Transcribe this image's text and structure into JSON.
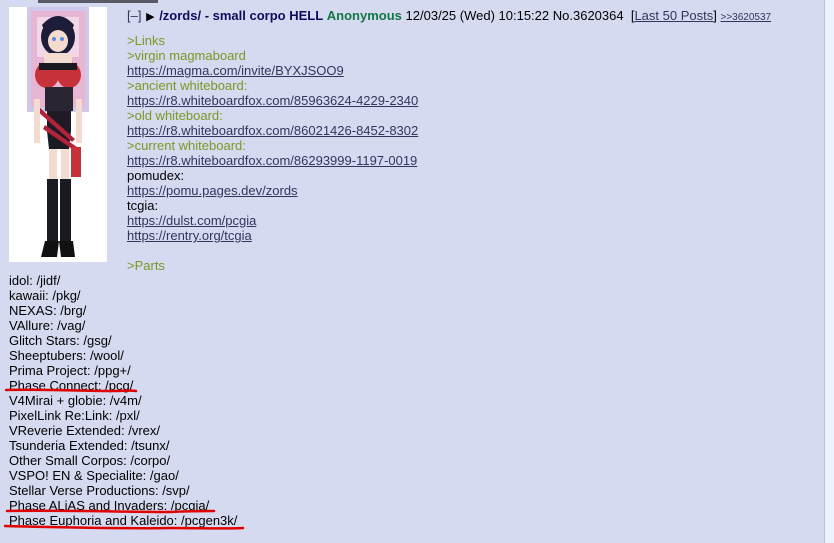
{
  "post": {
    "hide_label": "[–]",
    "subject": "/zords/ - small corpo HELL",
    "name": "Anonymous",
    "datetime": "12/03/25 (Wed) 10:15:22",
    "post_no": "No.3620364",
    "last50_label": "Last 50 Posts",
    "backlink": ">>3620537"
  },
  "body_upper": [
    {
      "kind": "quote",
      "text": ">Links"
    },
    {
      "kind": "quote",
      "text": ">virgin magmaboard"
    },
    {
      "kind": "url",
      "text": "https://magma.com/invite/BYXJSOO9"
    },
    {
      "kind": "quote",
      "text": ">ancient whiteboard:"
    },
    {
      "kind": "url",
      "text": "https://r8.whiteboardfox.com/85963624-4229-2340"
    },
    {
      "kind": "quote",
      "text": ">old whiteboard:"
    },
    {
      "kind": "url",
      "text": "https://r8.whiteboardfox.com/86021426-8452-8302"
    },
    {
      "kind": "quote",
      "text": ">current whiteboard:"
    },
    {
      "kind": "url",
      "text": "https://r8.whiteboardfox.com/86293999-1197-0019"
    },
    {
      "kind": "plain",
      "text": "pomudex:"
    },
    {
      "kind": "url",
      "text": "https://pomu.pages.dev/zords"
    },
    {
      "kind": "plain",
      "text": "tcgia:"
    },
    {
      "kind": "url",
      "text": "https://dulst.com/pcgia"
    },
    {
      "kind": "url",
      "text": "https://rentry.org/tcgia"
    },
    {
      "kind": "blank",
      "text": ""
    },
    {
      "kind": "quote",
      "text": ">Parts"
    }
  ],
  "body_lower": [
    {
      "kind": "plain",
      "text": "idol: /jidf/"
    },
    {
      "kind": "plain",
      "text": "kawaii: /pkg/"
    },
    {
      "kind": "plain",
      "text": "NEXAS: /brg/"
    },
    {
      "kind": "plain",
      "text": "VAllure: /vag/"
    },
    {
      "kind": "plain",
      "text": "Glitch Stars: /gsg/"
    },
    {
      "kind": "plain",
      "text": "Sheeptubers: /wool/"
    },
    {
      "kind": "plain",
      "text": "Prima Project: /ppg+/"
    },
    {
      "kind": "plain",
      "text": "Phase Connect: /pcg/"
    },
    {
      "kind": "plain",
      "text": "V4Mirai + globie: /v4m/"
    },
    {
      "kind": "plain",
      "text": "PixelLink Re:Link: /pxl/"
    },
    {
      "kind": "plain",
      "text": "VReverie Extended: /vrex/"
    },
    {
      "kind": "plain",
      "text": "Tsunderia Extended: /tsunx/"
    },
    {
      "kind": "plain",
      "text": "Other Small Corpos: /corpo/"
    },
    {
      "kind": "plain",
      "text": "VSPO! EN & Specialite: /gao/"
    },
    {
      "kind": "plain",
      "text": "Stellar Verse Productions: /svp/"
    },
    {
      "kind": "plain",
      "text": "Phase ALiAS and Invaders: /pcgia/"
    },
    {
      "kind": "plain",
      "text": "Phase Euphoria and Kaleido: /pcgen3k/"
    }
  ],
  "colors": {
    "quote": "#789922",
    "name": "#117743",
    "subject": "#0f0c5d",
    "link": "#34345c",
    "annotation": "#e00000"
  }
}
